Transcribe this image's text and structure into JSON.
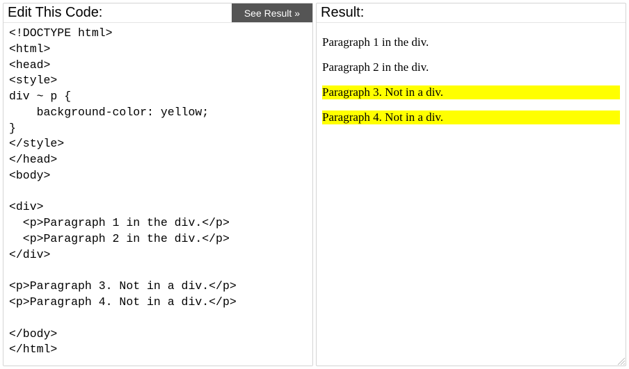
{
  "editor": {
    "title": "Edit This Code:",
    "button_label": "See Result »",
    "code": "<!DOCTYPE html>\n<html>\n<head>\n<style>\ndiv ~ p {\n    background-color: yellow;\n}\n</style>\n</head>\n<body>\n\n<div>\n  <p>Paragraph 1 in the div.</p>\n  <p>Paragraph 2 in the div.</p>\n</div>\n\n<p>Paragraph 3. Not in a div.</p>\n<p>Paragraph 4. Not in a div.</p>\n\n</body>\n</html>"
  },
  "result": {
    "title": "Result:",
    "paragraphs": [
      {
        "text": "Paragraph 1 in the div.",
        "highlight": false
      },
      {
        "text": "Paragraph 2 in the div.",
        "highlight": false
      },
      {
        "text": "Paragraph 3. Not in a div.",
        "highlight": true
      },
      {
        "text": "Paragraph 4. Not in a div.",
        "highlight": true
      }
    ]
  }
}
